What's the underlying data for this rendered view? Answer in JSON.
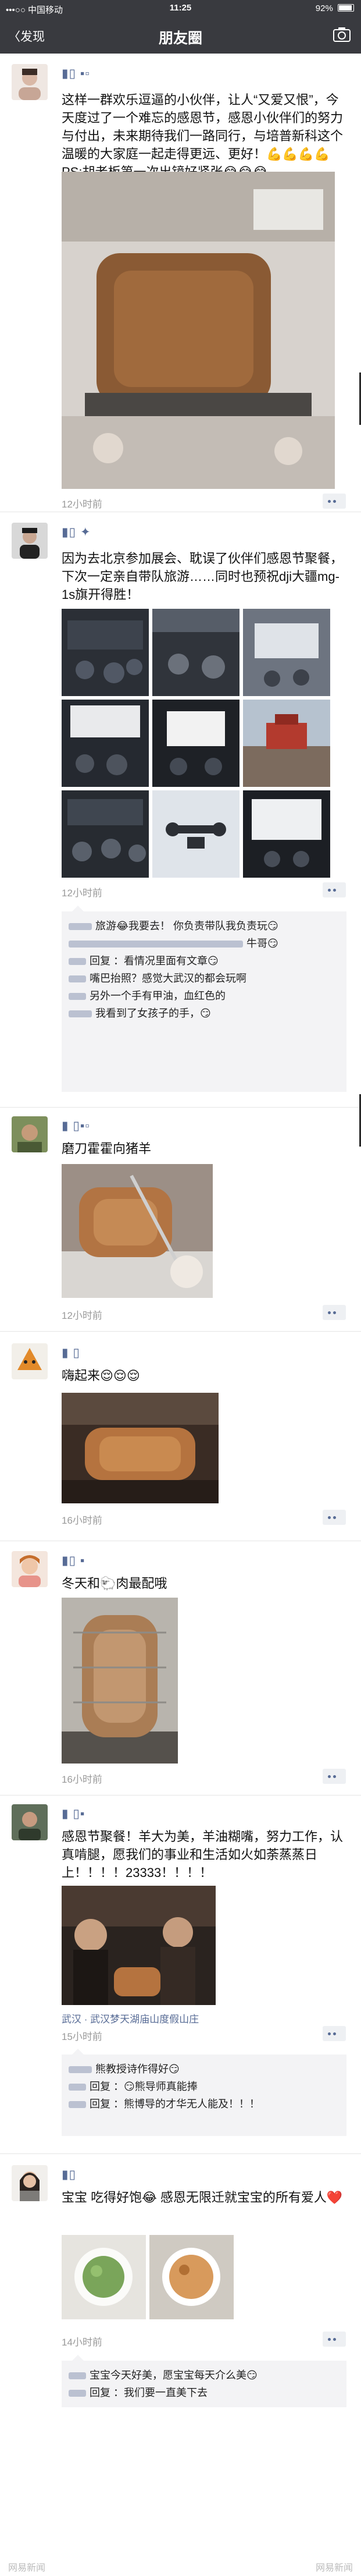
{
  "status": {
    "carrier": "•••○○ 中国移动",
    "time": "11:25",
    "battery": "92%",
    "battery_level": 0.92
  },
  "nav": {
    "back_label": "〈发现",
    "title": "朋友圈"
  },
  "posts": [
    {
      "text": "这样一群欢乐逗逼的小伙伴，让人“又爱又恨”，今天度过了一个难忘的感恩节，感恩小伙伴们的努力与付出，未来期待我们一路同行，与培普新科这个温暖的大家庭一起走得更远、更好！💪💪💪💪 PS:胡老板第一次出镜好紧张😂😂😂",
      "time": "12小时前"
    },
    {
      "text": "因为去北京参加展会、耽误了伙伴们感恩节聚餐，下次一定亲自带队旅游……同时也预祝dji大疆mg-1s旗开得胜！",
      "time": "12小时前",
      "comments": [
        "旅游😂我要去！ 你负责带队我负责玩😏",
        "牛哥😏",
        "回复 ：看情况里面有文章😏",
        "嘴巴抬照？感觉大武汉的都会玩啊",
        "另外一个手有甲油，血红色的",
        "我看到了女孩子的手，😏"
      ]
    },
    {
      "text": "磨刀霍霍向猪羊",
      "time": "12小时前"
    },
    {
      "text": "嗨起来😌😌😌",
      "time": "16小时前"
    },
    {
      "text": "冬天和🐑肉最配哦",
      "time": "16小时前"
    },
    {
      "text": "感恩节聚餐！羊大为美，羊油糊嘴，努力工作，认真啃腿，愿我们的事业和生活如火如荼蒸蒸日上！！！！23333！！！！",
      "location": "武汉 · 武汉梦天湖庙山度假山庄",
      "time": "15小时前",
      "comments": [
        "熊教授诗作得好😏",
        "回复 ：😏熊导师真能捧",
        "回复 ：熊博导的才华无人能及！！！"
      ]
    },
    {
      "text": "宝宝 吃得好饱😂 感恩无限迁就宝宝的所有爱人❤️",
      "time": "14小时前",
      "comments": [
        "宝宝今天好美，愿宝宝每天介么美😏",
        "回复 ：我们要一直美下去"
      ]
    }
  ],
  "watermark": "网易新闻"
}
